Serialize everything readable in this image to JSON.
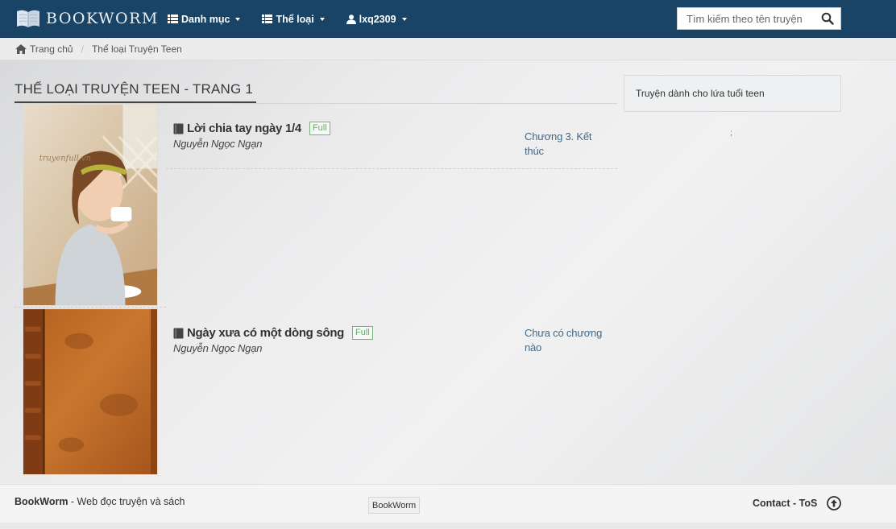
{
  "navbar": {
    "brand": "BOOKWORM",
    "menu": [
      {
        "label": "Danh mục",
        "icon": "list-icon"
      },
      {
        "label": "Thể loại",
        "icon": "list-icon"
      },
      {
        "label": "lxq2309",
        "icon": "user-icon"
      }
    ],
    "search_placeholder": "Tìm kiếm theo tên truyện"
  },
  "breadcrumb": {
    "home": "Trang chủ",
    "current": "Thể loại Truyện Teen"
  },
  "main": {
    "title": "Thể loại Truyện Teen - Trang 1",
    "stories": [
      {
        "title": "Lời chia tay ngày 1/4",
        "badge": "Full",
        "author": "Nguyễn Ngọc Ngạn",
        "chapter": "Chương 3. Kết thúc"
      },
      {
        "title": "Ngày xưa có một dòng sông",
        "badge": "Full",
        "author": "Nguyễn Ngọc Ngạn",
        "chapter": "Chưa có chương nào"
      }
    ]
  },
  "sidebar": {
    "description": "Truyện dành cho lứa tuổi teen",
    "dot": ";"
  },
  "footer": {
    "brand": "BookWorm",
    "tagline": " - Web đọc truyện và sách",
    "center_label": "BookWorm",
    "contact": "Contact",
    "separator": " - ",
    "tos": "ToS"
  },
  "colors": {
    "navbar": "#1a4466",
    "link": "#3d6b8c",
    "badge": "#6aa56a"
  }
}
